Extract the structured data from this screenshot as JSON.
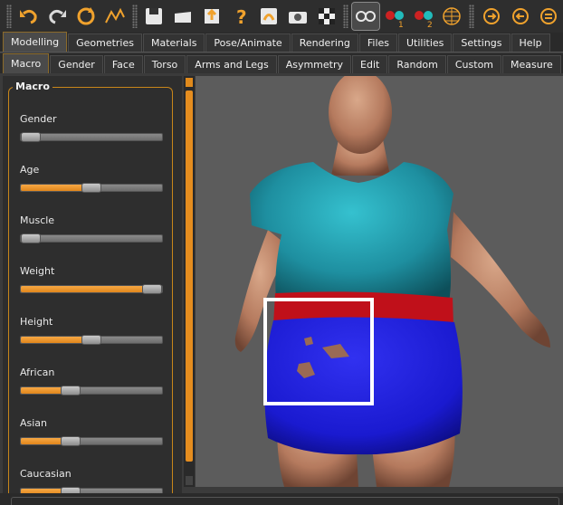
{
  "toolbar": {
    "buttons": [
      {
        "icon": "undo-icon"
      },
      {
        "icon": "redo-icon"
      },
      {
        "icon": "reset-icon"
      },
      {
        "icon": "smooth-icon"
      },
      {
        "icon": "save-icon"
      },
      {
        "icon": "load-icon"
      },
      {
        "icon": "export-icon"
      },
      {
        "icon": "help-icon"
      },
      {
        "icon": "pose-icon"
      },
      {
        "icon": "screenshot-icon"
      },
      {
        "icon": "background-checker-icon"
      },
      {
        "icon": "glasses-icon"
      },
      {
        "icon": "stereo1-icon"
      },
      {
        "icon": "stereo2-icon"
      },
      {
        "icon": "wireframe-icon"
      },
      {
        "icon": "front-view-icon"
      },
      {
        "icon": "back-view-icon"
      },
      {
        "icon": "side-view-icon"
      }
    ]
  },
  "main_tabs": [
    "Modelling",
    "Geometries",
    "Materials",
    "Pose/Animate",
    "Rendering",
    "Files",
    "Utilities",
    "Settings",
    "Help"
  ],
  "sub_tabs": [
    "Macro",
    "Gender",
    "Face",
    "Torso",
    "Arms and Legs",
    "Asymmetry",
    "Edit",
    "Random",
    "Custom",
    "Measure"
  ],
  "panel": {
    "title": "Macro",
    "sliders": [
      {
        "label": "Gender",
        "value": 0.06
      },
      {
        "label": "Age",
        "value": 0.5
      },
      {
        "label": "Muscle",
        "value": 0.06
      },
      {
        "label": "Weight",
        "value": 0.95
      },
      {
        "label": "Height",
        "value": 0.5
      },
      {
        "label": "African",
        "value": 0.35
      },
      {
        "label": "Asian",
        "value": 0.35
      },
      {
        "label": "Caucasian",
        "value": 0.35
      }
    ]
  },
  "colors": {
    "accent": "#e58d1f",
    "skin": "#b57a5e",
    "shirt": "#1e8fa0",
    "skirt": "#1a1ad0",
    "waistband": "#c0101a"
  }
}
